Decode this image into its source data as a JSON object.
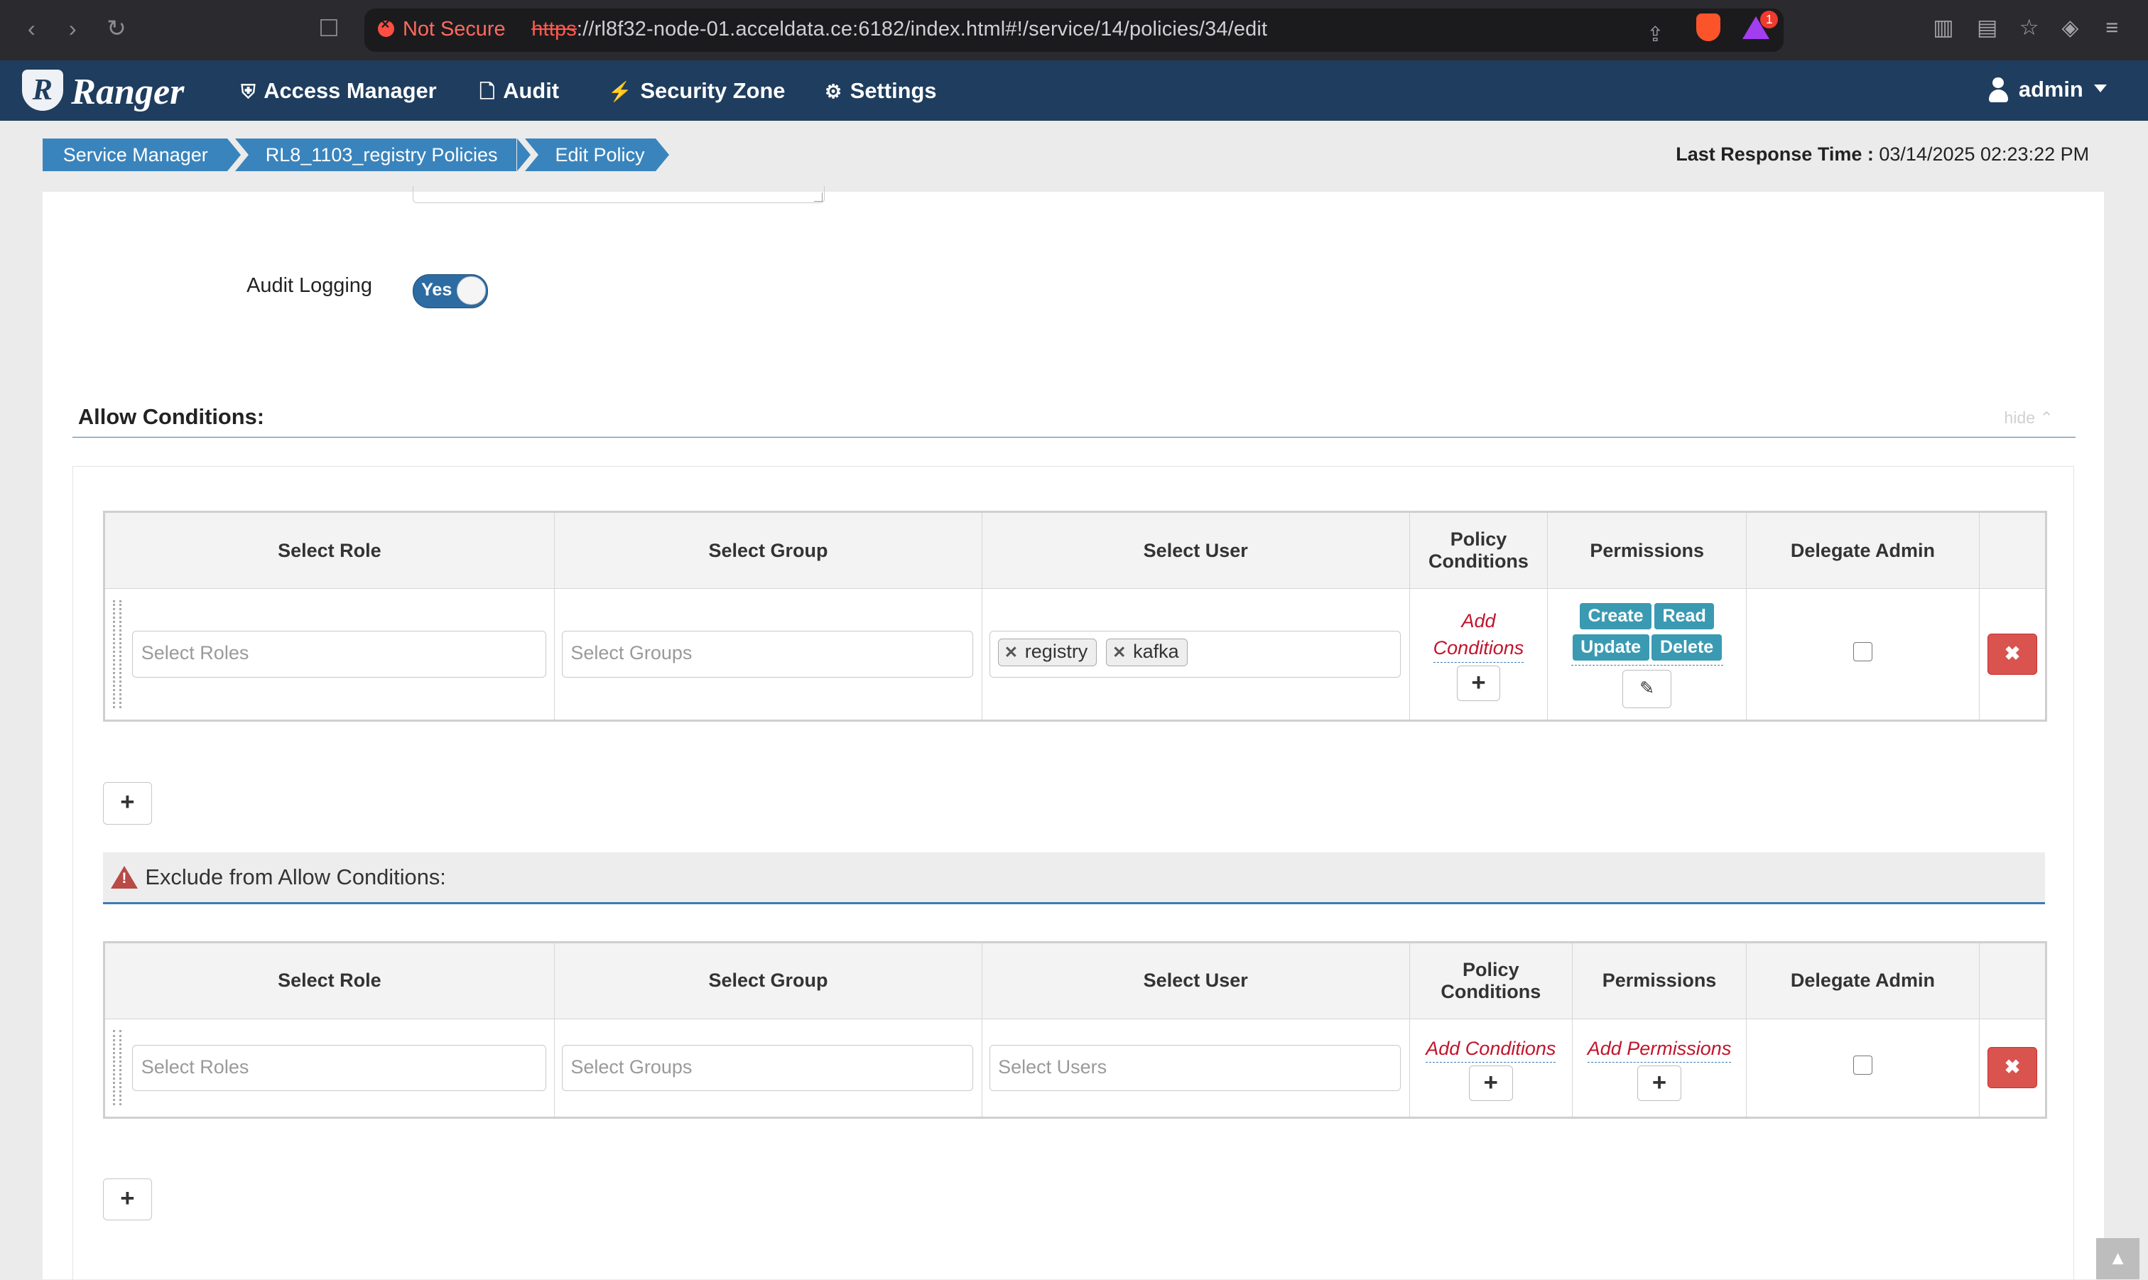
{
  "browser": {
    "security_label": "Not Secure",
    "url_protocol": "https",
    "url_rest": "://rl8f32-node-01.acceldata.ce:6182/index.html#!/service/14/policies/34/edit",
    "notification_count": "1"
  },
  "navbar": {
    "brand": "Ranger",
    "brand_initial": "R",
    "items": [
      {
        "label": "Access Manager",
        "icon": "shield-icon"
      },
      {
        "label": "Audit",
        "icon": "file-icon"
      },
      {
        "label": "Security Zone",
        "icon": "bolt-icon"
      },
      {
        "label": "Settings",
        "icon": "gear-icon"
      }
    ],
    "user": "admin"
  },
  "breadcrumb": [
    "Service Manager",
    "RL8_1103_registry Policies",
    "Edit Policy"
  ],
  "last_response": {
    "label": "Last Response Time :",
    "value": "03/14/2025 02:23:22 PM"
  },
  "form": {
    "audit_logging_label": "Audit Logging",
    "audit_logging_value": "Yes"
  },
  "allow": {
    "title": "Allow Conditions:",
    "hide_label": "hide",
    "headers": {
      "role": "Select Role",
      "group": "Select Group",
      "user": "Select User",
      "conditions_1": "Policy",
      "conditions_2": "Conditions",
      "permissions": "Permissions",
      "delegate": "Delegate Admin"
    },
    "row": {
      "roles_placeholder": "Select Roles",
      "groups_placeholder": "Select Groups",
      "users": [
        "registry",
        "kafka"
      ],
      "add_conditions_1": "Add",
      "add_conditions_2": "Conditions",
      "permissions": [
        "Create",
        "Read",
        "Update",
        "Delete"
      ],
      "delegate_admin": false
    }
  },
  "exclude": {
    "title": "Exclude from Allow Conditions:",
    "headers": {
      "role": "Select Role",
      "group": "Select Group",
      "user": "Select User",
      "conditions_1": "Policy",
      "conditions_2": "Conditions",
      "permissions": "Permissions",
      "delegate": "Delegate Admin"
    },
    "row": {
      "roles_placeholder": "Select Roles",
      "groups_placeholder": "Select Groups",
      "users_placeholder": "Select Users",
      "add_conditions": "Add Conditions",
      "add_permissions": "Add Permissions",
      "delegate_admin": false
    }
  },
  "colors": {
    "navbar": "#1f3d5e",
    "breadcrumb": "#3a84bd",
    "permission_tag": "#3a9ab2",
    "delete_button": "#d9534f",
    "add_link": "#c0152d"
  }
}
